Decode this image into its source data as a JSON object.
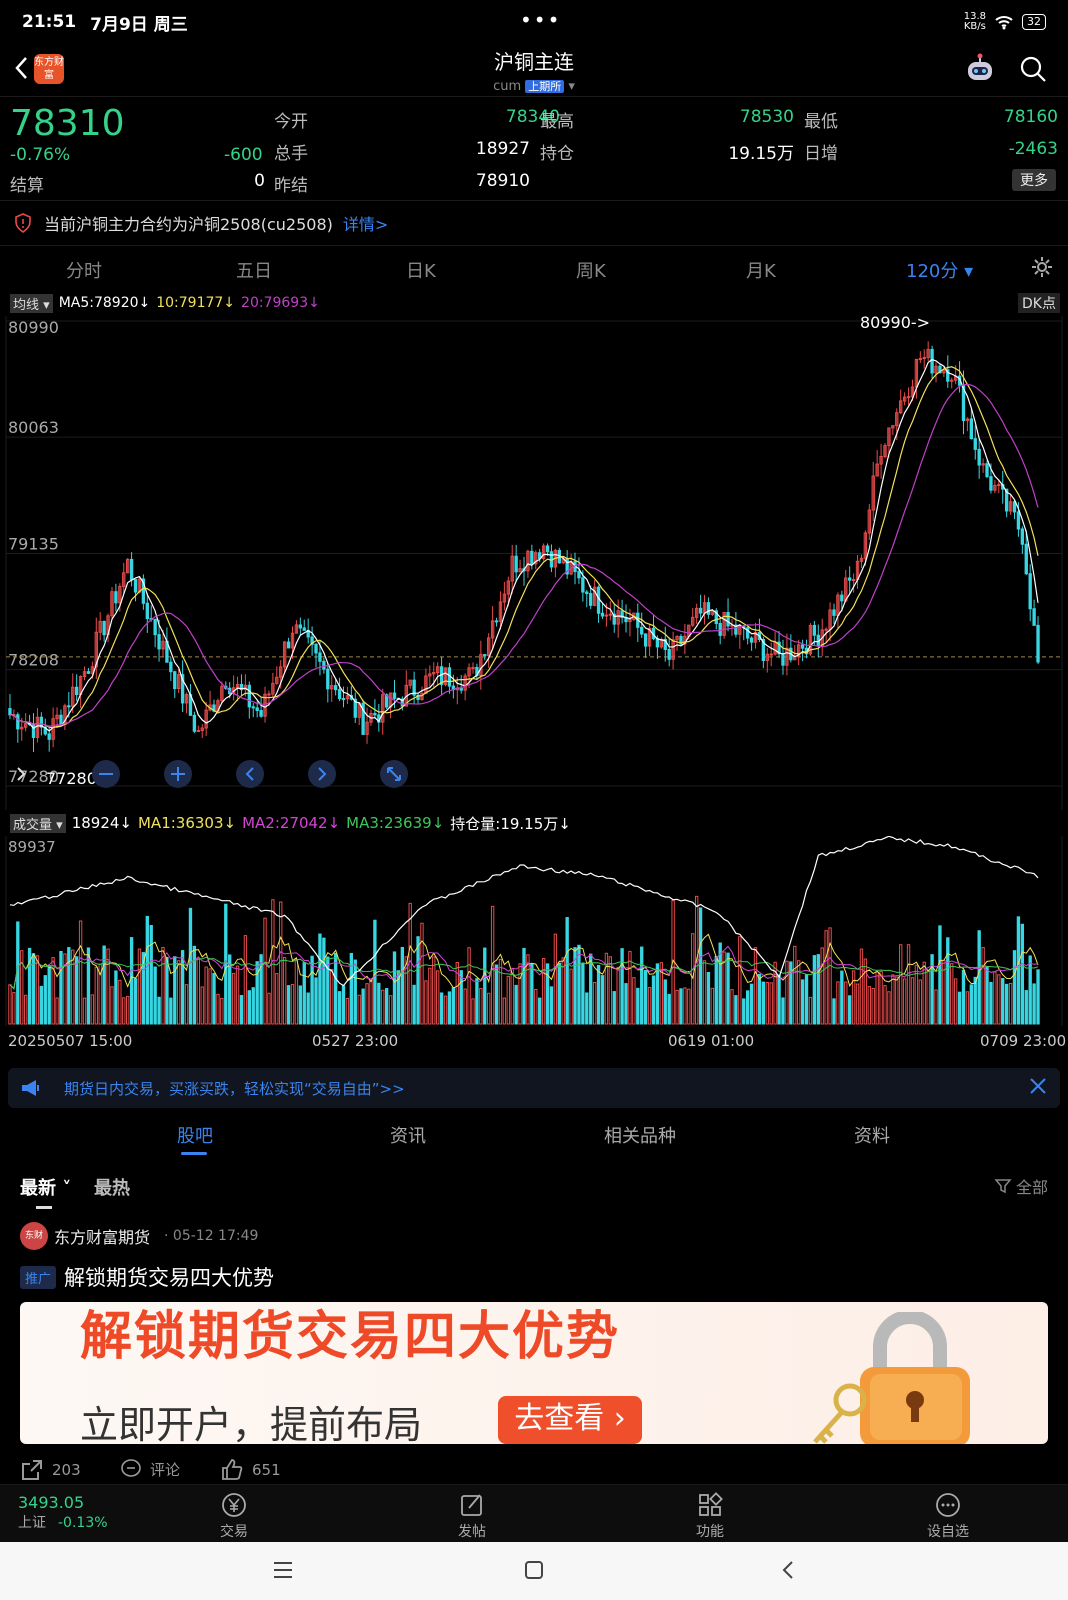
{
  "status": {
    "time": "21:51",
    "date": "7月9日 周三",
    "netspeed": "13.8",
    "netunit": "KB/s",
    "battery": "32"
  },
  "header": {
    "title": "沪铜主连",
    "code": "cum",
    "exchange": "上期所",
    "logo_text": "东方财富"
  },
  "quote": {
    "price": "78310",
    "pct": "-0.76%",
    "change": "-600",
    "fields": [
      {
        "label": "今开",
        "value": "78340"
      },
      {
        "label": "最高",
        "value": "78530"
      },
      {
        "label": "最低",
        "value": "78160"
      },
      {
        "label": "总手",
        "value": "18927"
      },
      {
        "label": "持仓",
        "value": "19.15万"
      },
      {
        "label": "日增",
        "value": "-2463"
      },
      {
        "label": "结算",
        "value": "0"
      },
      {
        "label": "昨结",
        "value": "78910"
      }
    ],
    "more": "更多"
  },
  "notice": {
    "text": "当前沪铜主力合约为沪铜2508(cu2508)",
    "link": "详情>"
  },
  "periods": [
    "分时",
    "五日",
    "日K",
    "周K",
    "月K",
    "120分"
  ],
  "ma": {
    "tag": "均线",
    "ma5": "MA5:78920↓",
    "ma10": "10:79177↓",
    "ma20": "20:79693↓",
    "dk": "DK点"
  },
  "chart_data": {
    "type": "candlestick",
    "y_ticks": [
      "80990",
      "80063",
      "79135",
      "78208",
      "77280"
    ],
    "max_label": "80990->",
    "min_label": "77280",
    "ylim": [
      77280,
      80990
    ],
    "x_labels": [
      "20250507 15:00",
      "0527 23:00",
      "0619 01:00",
      "0709 23:00"
    ]
  },
  "volume": {
    "tag": "成交量",
    "value": "18924↓",
    "ma1": "MA1:36303↓",
    "ma2": "MA2:27042↓",
    "ma3": "MA3:23639↓",
    "oi": "持仓量:19.15万↓",
    "max": "89937"
  },
  "ad": {
    "text": "期货日内交易，买涨买跌，轻松实现“交易自由”>>"
  },
  "tabs": [
    "股吧",
    "资讯",
    "相关品种",
    "资料"
  ],
  "sort": {
    "latest": "最新",
    "hot": "最热",
    "filter": "全部"
  },
  "post": {
    "author": "东方财富期货",
    "avatar_text": "东财",
    "time": "05-12 17:49",
    "tag": "推广",
    "title": "解锁期货交易四大优势",
    "banner_title": "解锁期货交易四大优势",
    "banner_sub": "立即开户，提前布局",
    "banner_btn": "去查看 ›",
    "shares": "203",
    "comments": "评论",
    "likes": "651"
  },
  "bottom": {
    "index_value": "3493.05",
    "index_name": "上证",
    "index_pct": "-0.13%",
    "trade": "交易",
    "post": "发帖",
    "func": "功能",
    "watch": "设自选"
  },
  "colors": {
    "up": "#e84b4b",
    "down": "#37d6e2",
    "green": "#35d38a",
    "accent": "#3a84f0"
  }
}
